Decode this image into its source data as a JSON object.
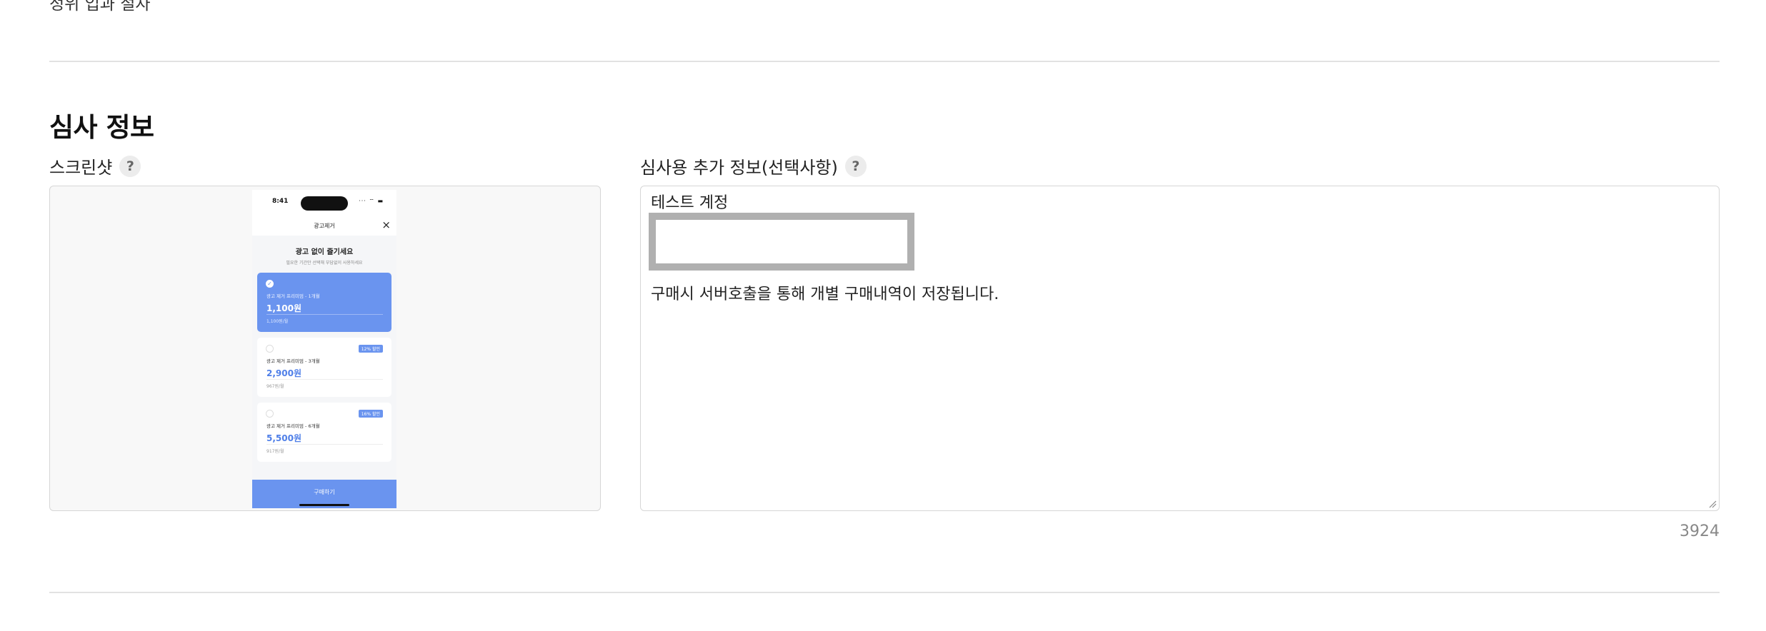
{
  "previous_section": {
    "clipped_label": "정위 입과 절자"
  },
  "section": {
    "title": "심사 정보"
  },
  "screenshot_field": {
    "label": "스크린샷",
    "help_symbol": "?",
    "phone": {
      "time": "8:41",
      "status_icons": "···  ⌔ ▬",
      "nav_title": "광고제거",
      "close_symbol": "×",
      "headline": "광고 없이 즐기세요",
      "subline": "필요한 기간만 선택해 부담없이 사용하세요",
      "plans": [
        {
          "name": "광고 제거 프리미엄 - 1개월",
          "price": "1,100원",
          "monthly": "1,100원/월",
          "selected": true,
          "badge": ""
        },
        {
          "name": "광고 제거 프리미엄 - 3개월",
          "price": "2,900원",
          "monthly": "967원/월",
          "selected": false,
          "badge": "12% 할인"
        },
        {
          "name": "광고 제거 프리미엄 - 6개월",
          "price": "5,500원",
          "monthly": "917원/월",
          "selected": false,
          "badge": "16% 할인"
        }
      ],
      "check_symbol": "✓",
      "buy_label": "구매하기",
      "accent": "#6a94ef"
    }
  },
  "review_field": {
    "label": "심사용 추가 정보(선택사항)",
    "help_symbol": "?",
    "line1": "테스트 계정",
    "line2": "구매시 서버호출을 통해 개별 구매내역이 저장됩니다.",
    "char_count": "3924"
  },
  "icons": {
    "help": "help-circle-icon",
    "close": "close-icon",
    "check": "check-circle-icon",
    "resize": "resize-grip-icon"
  }
}
